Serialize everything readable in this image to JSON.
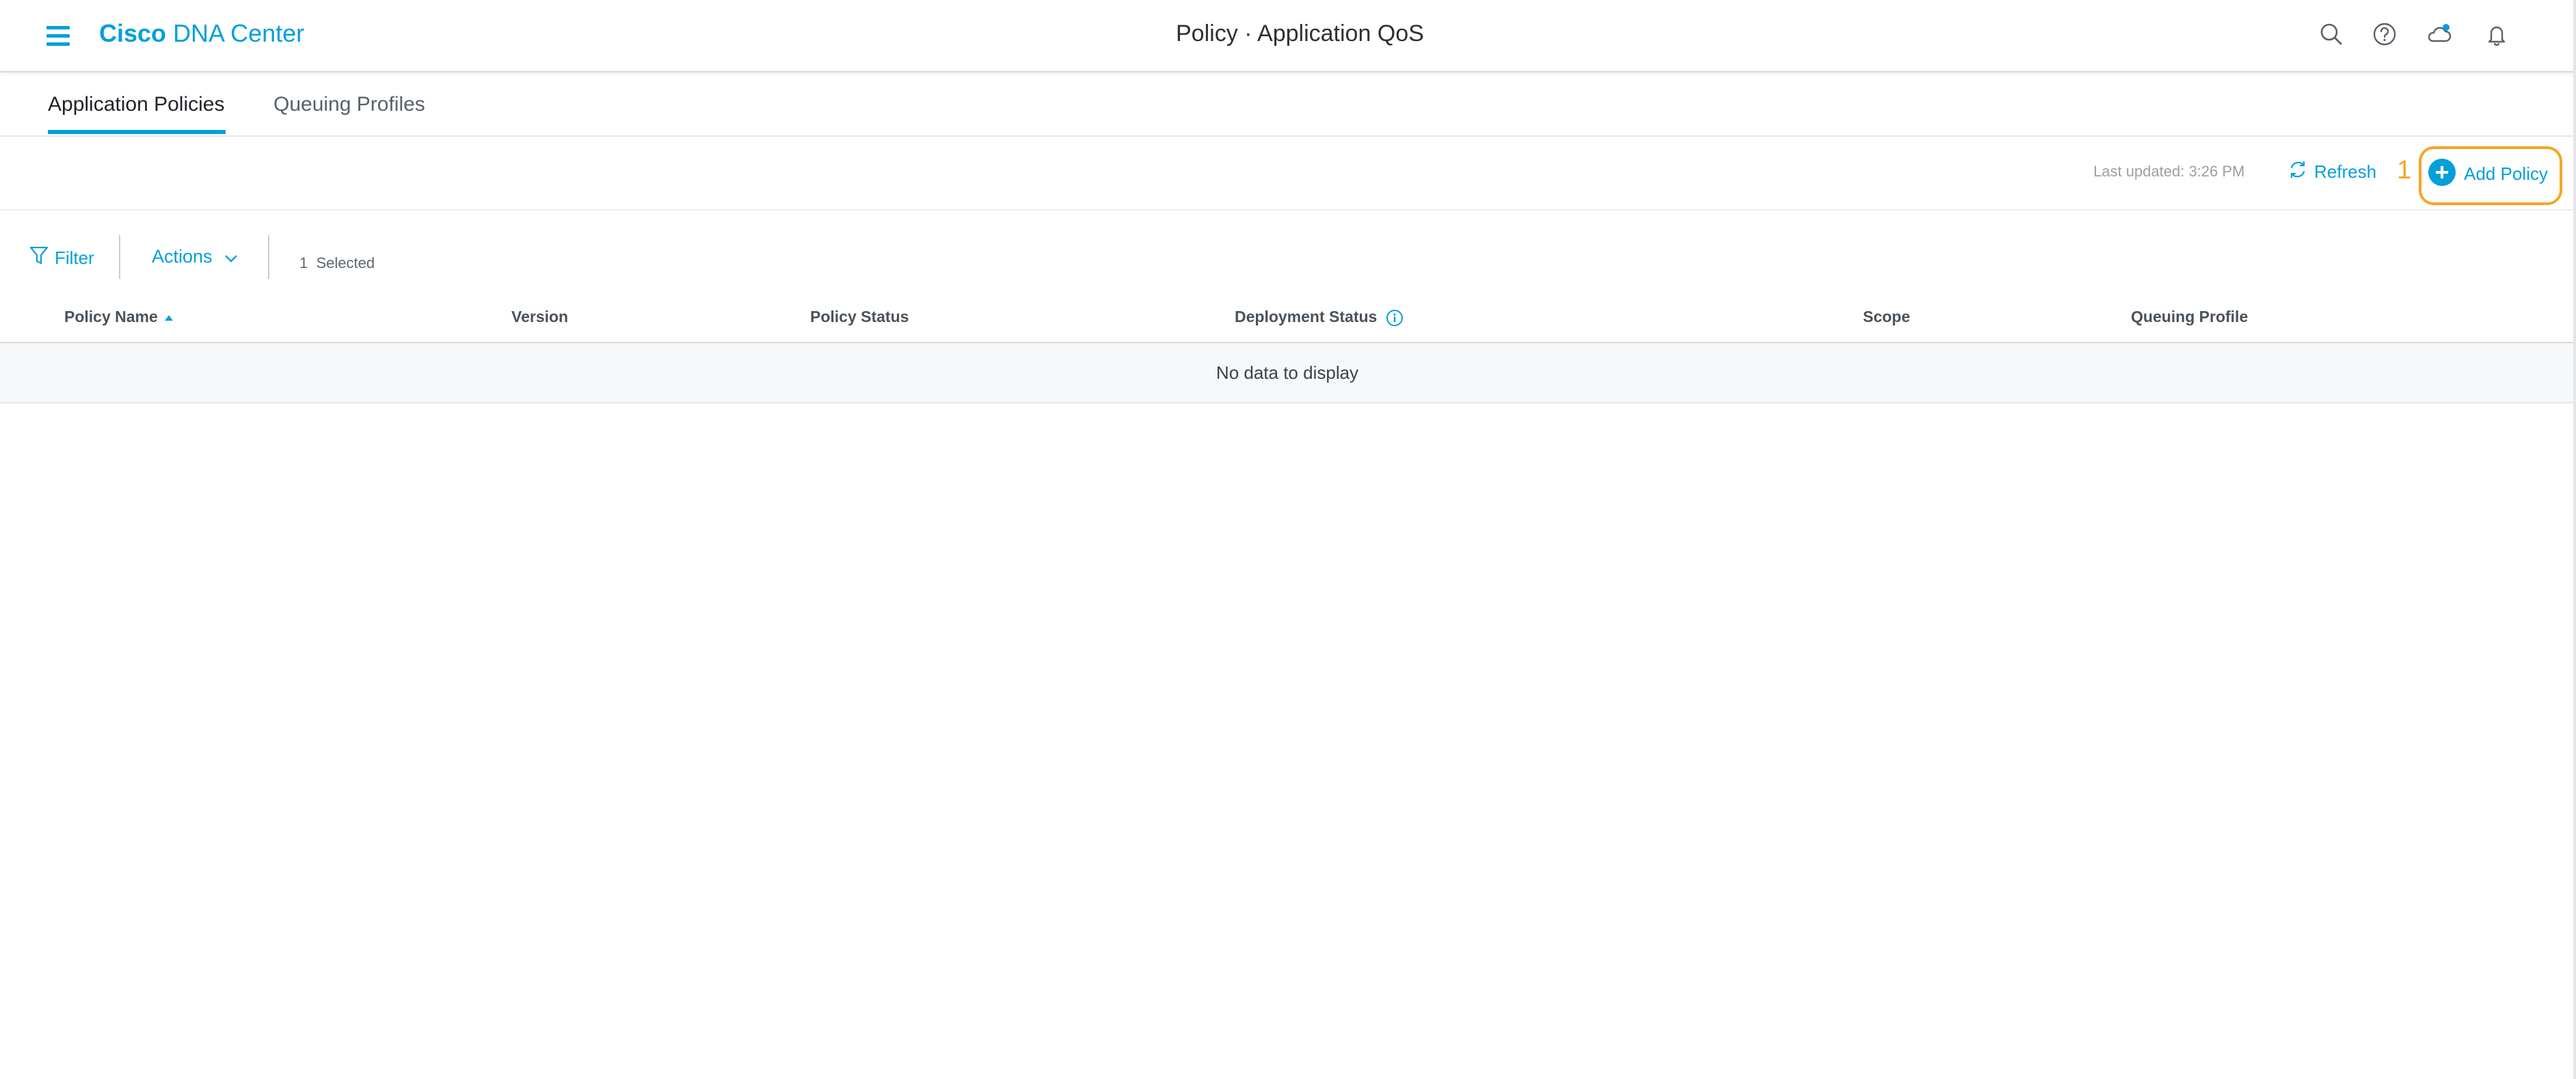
{
  "header": {
    "menu_icon": "hamburger-menu-icon",
    "brand_bold": "Cisco",
    "brand_rest": "DNA Center",
    "page_title": "Policy · Application QoS",
    "icons": [
      "search-icon",
      "help-icon",
      "cloud-icon",
      "bell-icon"
    ]
  },
  "tabs": [
    {
      "label": "Application Policies",
      "active": true
    },
    {
      "label": "Queuing Profiles",
      "active": false
    }
  ],
  "toolbar": {
    "last_updated": "Last updated: 3:26 PM",
    "refresh_label": "Refresh",
    "step_number": "1",
    "add_policy_label": "Add Policy"
  },
  "filterbar": {
    "filter_label": "Filter",
    "actions_label": "Actions",
    "selected_count": "1",
    "selected_label": "Selected"
  },
  "table": {
    "columns": [
      "Policy Name",
      "Version",
      "Policy Status",
      "Deployment Status",
      "Scope",
      "Queuing Profile"
    ],
    "sorted_column": "Policy Name",
    "sort_direction": "ascending",
    "empty_message": "No data to display"
  },
  "colors": {
    "accent": "#049fd9",
    "highlight": "#f5a623"
  }
}
